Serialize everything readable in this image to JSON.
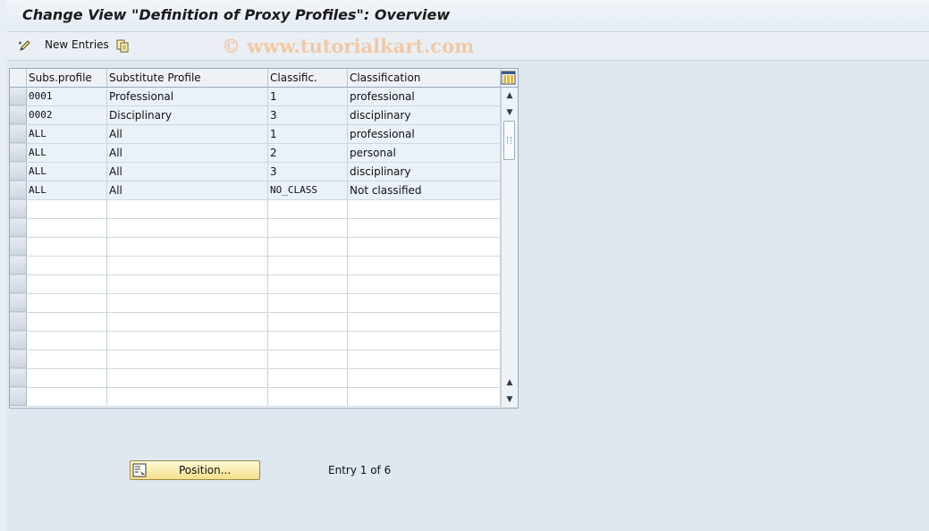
{
  "window": {
    "title": "Change View \"Definition of Proxy Profiles\": Overview"
  },
  "toolbar": {
    "new_entries_label": "New Entries",
    "watermark": "© www.tutorialkart.com"
  },
  "table": {
    "columns": [
      "Subs.profile",
      "Substitute Profile",
      "Classific.",
      "Classification"
    ],
    "rows": [
      [
        "0001",
        "Professional",
        "1",
        "professional"
      ],
      [
        "0002",
        "Disciplinary",
        "3",
        "disciplinary"
      ],
      [
        "ALL",
        "All",
        "1",
        "professional"
      ],
      [
        "ALL",
        "All",
        "2",
        "personal"
      ],
      [
        "ALL",
        "All",
        "3",
        "disciplinary"
      ],
      [
        "ALL",
        "All",
        "NO_CLASS",
        "Not classified"
      ]
    ],
    "empty_rows": 11
  },
  "footer": {
    "position_label": "Position...",
    "entry_info": "Entry 1 of 6"
  },
  "colors": {
    "accent_button": "#f5e08a",
    "row_filled": "#eaf1f8",
    "watermark": "#f2c9a4"
  }
}
